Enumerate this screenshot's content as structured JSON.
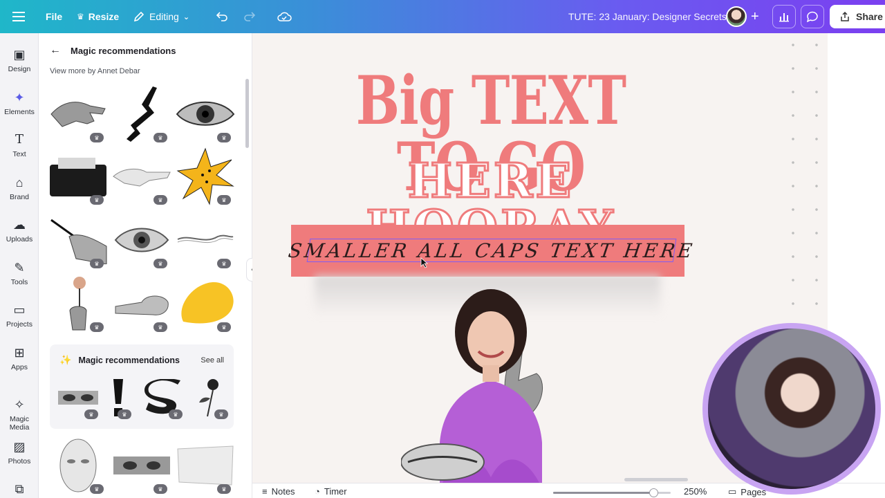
{
  "topbar": {
    "file_label": "File",
    "resize_label": "Resize",
    "editing_label": "Editing",
    "doc_title": "TUTE: 23 January: Designer Secrets",
    "share_label": "Share"
  },
  "rail": {
    "items": [
      {
        "label": "Design",
        "icon": "design-icon"
      },
      {
        "label": "Elements",
        "icon": "elements-icon"
      },
      {
        "label": "Text",
        "icon": "text-icon"
      },
      {
        "label": "Brand",
        "icon": "brand-icon"
      },
      {
        "label": "Uploads",
        "icon": "uploads-icon"
      },
      {
        "label": "Tools",
        "icon": "tools-icon"
      },
      {
        "label": "Projects",
        "icon": "projects-icon"
      },
      {
        "label": "Apps",
        "icon": "apps-icon"
      },
      {
        "label": "Magic Media",
        "icon": "magic-media-icon"
      },
      {
        "label": "Photos",
        "icon": "photos-icon"
      }
    ]
  },
  "panel": {
    "title": "Magic recommendations",
    "subtitle": "View more by Annet Debar",
    "card_title": "Magic recommendations",
    "see_all": "See all"
  },
  "canvas": {
    "headline_1": "Big TEXT TO GO",
    "headline_2": "HERE HOORAY",
    "banner_text": "SMALLER ALL CAPS TEXT HERE"
  },
  "bottombar": {
    "notes_label": "Notes",
    "timer_label": "Timer",
    "zoom_label": "250%",
    "zoom_fraction": 0.85,
    "pages_label": "Pages"
  },
  "colors": {
    "accent": "#7b3ff0",
    "headline": "#ef7b7c",
    "banner": "#ef7b7c",
    "webcam_ring": "#c8a4f2"
  }
}
